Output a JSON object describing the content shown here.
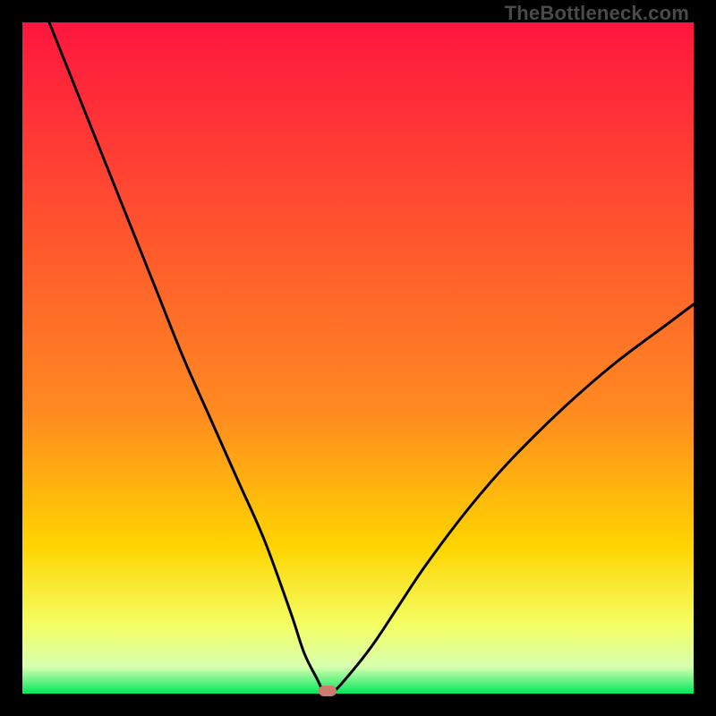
{
  "watermark": "TheBottleneck.com",
  "colors": {
    "bg_black": "#000000",
    "grad_top": "#ff163e",
    "grad_upper_mid": "#ff8a20",
    "grad_mid": "#ffd400",
    "grad_lower_mid": "#f3ff66",
    "grad_near_bottom": "#d8ffb0",
    "grad_bottom": "#00e85a",
    "curve": "#000000",
    "marker": "#cf7a6f"
  },
  "chart_data": {
    "type": "line",
    "title": "",
    "xlabel": "",
    "ylabel": "",
    "xlim": [
      0,
      100
    ],
    "ylim": [
      0,
      100
    ],
    "series": [
      {
        "name": "bottleneck-curve",
        "x": [
          4,
          8,
          12,
          16,
          20,
          24,
          28,
          32,
          36,
          40,
          42,
          44,
          45,
          46,
          48,
          52,
          56,
          60,
          66,
          72,
          80,
          88,
          96,
          100
        ],
        "values": [
          100,
          90,
          80,
          70,
          60,
          50,
          41,
          32,
          23,
          12,
          6,
          2,
          0,
          0,
          2,
          7,
          13,
          19,
          27,
          34,
          42,
          49,
          55,
          58
        ]
      }
    ],
    "marker": {
      "x": 45.5,
      "y": 0.4
    },
    "gradient_stops_pct": [
      0,
      35,
      58,
      78,
      90,
      96,
      100
    ]
  }
}
